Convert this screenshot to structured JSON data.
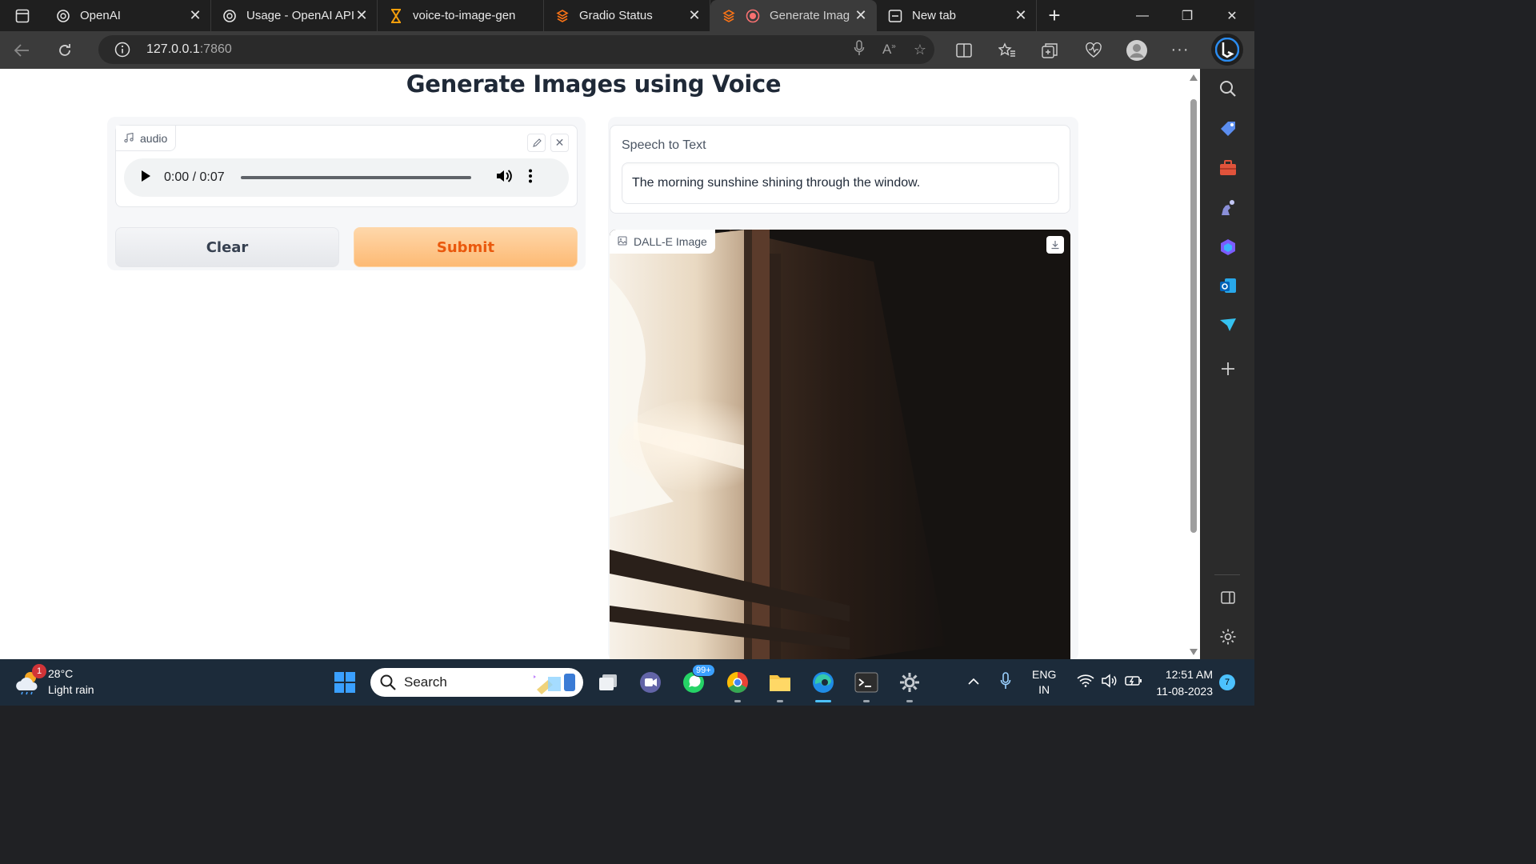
{
  "browser": {
    "tabs": [
      {
        "title": "OpenAI",
        "icon": "openai-icon",
        "active": false
      },
      {
        "title": "Usage - OpenAI API",
        "icon": "openai-icon",
        "active": false
      },
      {
        "title": "voice-to-image-gen",
        "icon": "hourglass-icon",
        "active": false
      },
      {
        "title": "Gradio Status",
        "icon": "gradio-icon",
        "active": false
      },
      {
        "title": "Generate Imag",
        "icon": "gradio-icon",
        "active": true
      },
      {
        "title": "New tab",
        "icon": "newtab-icon",
        "active": false
      }
    ],
    "url_host": "127.0.0.1",
    "url_port": ":7860"
  },
  "app": {
    "title": "Generate Images using Voice",
    "audio": {
      "label": "audio",
      "time": "0:00 / 0:07",
      "progress": 0
    },
    "buttons": {
      "clear": "Clear",
      "submit": "Submit"
    },
    "speech": {
      "label": "Speech to Text",
      "value": "The morning sunshine shining through the window."
    },
    "image": {
      "label": "DALL-E Image"
    }
  },
  "taskbar": {
    "weather": {
      "temp": "28°C",
      "desc": "Light rain",
      "badge": "1"
    },
    "search": "Search",
    "whatsapp_badge": "99+",
    "lang": "ENG",
    "region": "IN",
    "time": "12:51 AM",
    "date": "11-08-2023",
    "notifications": "7"
  },
  "colors": {
    "submit_text": "#ea580c",
    "submit_bg": "#fdba74",
    "accent": "#0078d4"
  }
}
